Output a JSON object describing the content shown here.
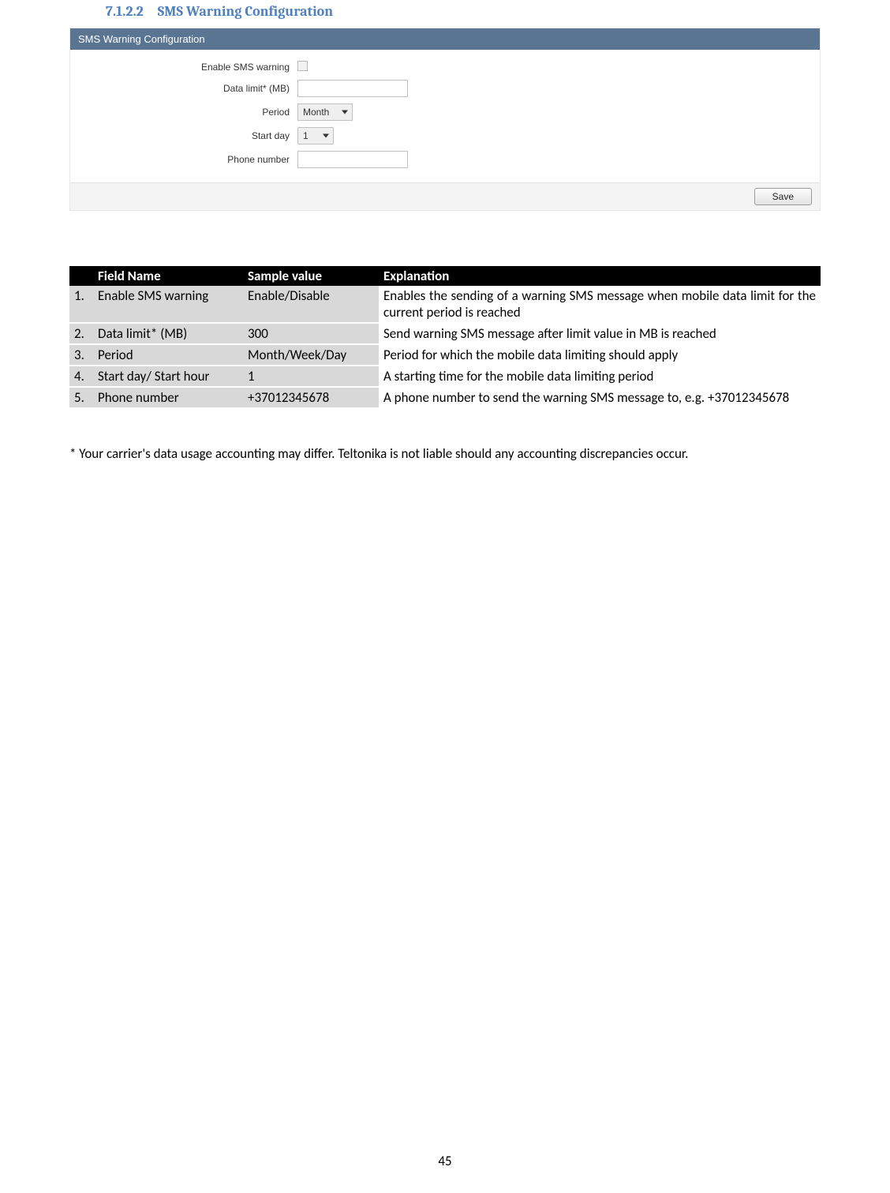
{
  "heading": {
    "number": "7.1.2.2",
    "title": "SMS Warning Configuration"
  },
  "panel": {
    "title": "SMS Warning Configuration",
    "fields": {
      "enable_label": "Enable SMS warning",
      "data_limit_label": "Data limit* (MB)",
      "period_label": "Period",
      "period_value": "Month",
      "start_day_label": "Start day",
      "start_day_value": "1",
      "phone_label": "Phone number"
    },
    "save_label": "Save"
  },
  "table": {
    "headers": {
      "nr": "",
      "field": "Field Name",
      "sample": "Sample value",
      "explanation": "Explanation"
    },
    "rows": [
      {
        "nr": "1.",
        "field": "Enable SMS warning",
        "sample": "Enable/Disable",
        "explanation": "Enables the sending of a warning SMS message when mobile data limit for the current period is reached"
      },
      {
        "nr": "2.",
        "field": "Data limit* (MB)",
        "sample": "300",
        "explanation": "Send warning SMS message after limit value in MB is reached"
      },
      {
        "nr": "3.",
        "field": "Period",
        "sample": "Month/Week/Day",
        "explanation": "Period for which the mobile data limiting should apply"
      },
      {
        "nr": "4.",
        "field": "Start day/ Start hour",
        "sample": "1",
        "explanation": "A starting time for the mobile data limiting period"
      },
      {
        "nr": "5.",
        "field": "Phone number",
        "sample": "+37012345678",
        "explanation": "A phone number to send the warning SMS message to, e.g. +37012345678"
      }
    ]
  },
  "footnote": "* Your carrier's data usage accounting may differ. Teltonika is not liable should any accounting discrepancies occur.",
  "page_number": "45"
}
